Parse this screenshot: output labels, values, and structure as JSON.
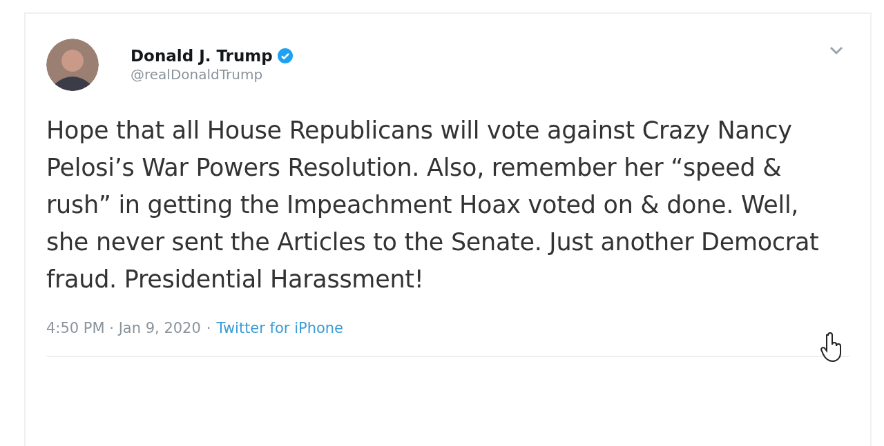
{
  "tweet": {
    "author": {
      "name": "Donald J. Trump",
      "verified": true,
      "handle": "@realDonaldTrump"
    },
    "text": "Hope that all House Republicans will vote against Crazy Nancy Pelosi’s War Powers Resolution. Also, remember her “speed & rush” in getting the Impeachment Hoax voted on & done. Well, she never sent the Articles to the Senate. Just another Democrat fraud. Presidential Harassment!",
    "time": "4:50 PM · Jan 9, 2020",
    "separator": "·",
    "source": "Twitter for iPhone"
  }
}
